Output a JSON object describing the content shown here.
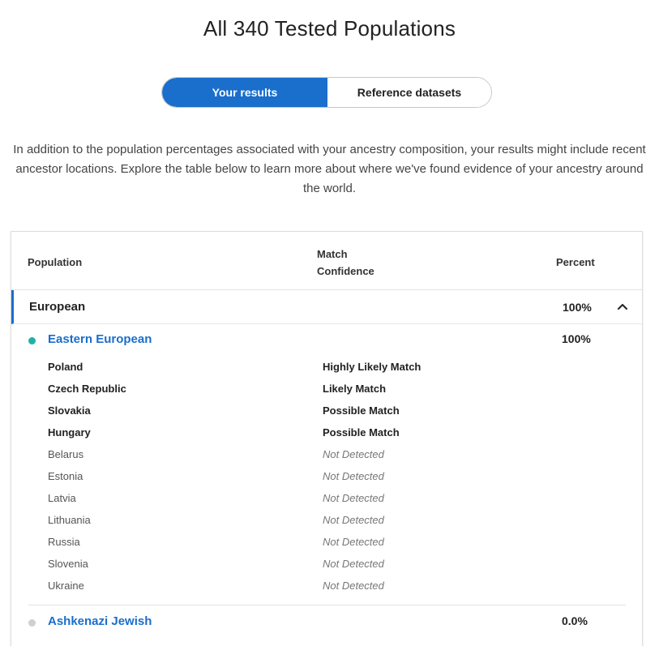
{
  "page": {
    "title": "All 340 Tested Populations"
  },
  "toggle": {
    "your_results": "Your results",
    "reference_datasets": "Reference datasets"
  },
  "intro": "In addition to the population percentages associated with your ancestry composition, your results might include recent ancestor locations. Explore the table below to learn more about where we've found evidence of your ancestry around the world.",
  "table": {
    "headers": {
      "population": "Population",
      "match_line1": "Match",
      "match_line2": "Confidence",
      "percent": "Percent"
    },
    "region": {
      "name": "European",
      "percent": "100%",
      "expanded": true
    },
    "subregions": [
      {
        "name": "Eastern European",
        "percent": "100%",
        "dot_color": "#21b2a6"
      },
      {
        "name": "Ashkenazi Jewish",
        "percent": "0.0%",
        "dot_color": "#cfcfcf"
      }
    ],
    "countries": [
      {
        "name": "Poland",
        "match": "Highly Likely Match",
        "detected": true
      },
      {
        "name": "Czech Republic",
        "match": "Likely Match",
        "detected": true
      },
      {
        "name": "Slovakia",
        "match": "Possible Match",
        "detected": true
      },
      {
        "name": "Hungary",
        "match": "Possible Match",
        "detected": true
      },
      {
        "name": "Belarus",
        "match": "Not Detected",
        "detected": false
      },
      {
        "name": "Estonia",
        "match": "Not Detected",
        "detected": false
      },
      {
        "name": "Latvia",
        "match": "Not Detected",
        "detected": false
      },
      {
        "name": "Lithuania",
        "match": "Not Detected",
        "detected": false
      },
      {
        "name": "Russia",
        "match": "Not Detected",
        "detected": false
      },
      {
        "name": "Slovenia",
        "match": "Not Detected",
        "detected": false
      },
      {
        "name": "Ukraine",
        "match": "Not Detected",
        "detected": false
      }
    ]
  },
  "colors": {
    "accent": "#1a6ecc",
    "eastern_european_dot": "#21b2a6",
    "ashkenazi_dot": "#cfcfcf"
  },
  "icons": {
    "collapse": "chevron-up-icon",
    "subregion_marker": "dot-icon"
  }
}
